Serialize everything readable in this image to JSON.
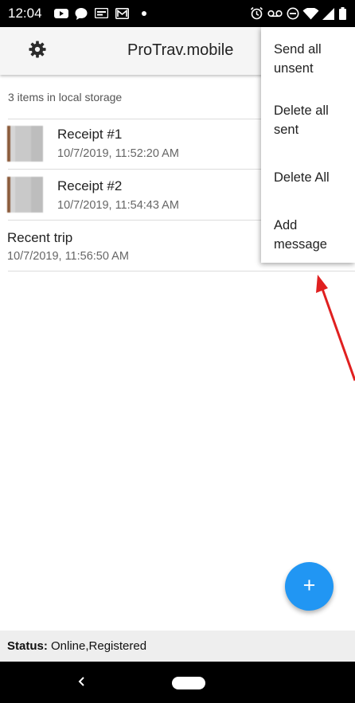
{
  "status_bar": {
    "time": "12:04",
    "icons": [
      "youtube-icon",
      "chat-icon",
      "gmail-card-icon",
      "gmail-icon",
      "dot-icon",
      "alarm-icon",
      "voicemail-icon",
      "do-not-disturb-icon",
      "wifi-icon",
      "signal-icon",
      "battery-icon"
    ]
  },
  "app_bar": {
    "title": "ProTrav.mobile",
    "settings_icon": "gear-icon"
  },
  "storage": {
    "count_text": "3 items in local storage"
  },
  "items": [
    {
      "title": "Receipt #1",
      "timestamp": "10/7/2019, 11:52:20 AM",
      "has_thumbnail": true
    },
    {
      "title": "Receipt #2",
      "timestamp": "10/7/2019, 11:54:43 AM",
      "has_thumbnail": true
    },
    {
      "title": "Recent trip",
      "timestamp": "10/7/2019, 11:56:50 AM",
      "has_thumbnail": false
    }
  ],
  "menu": {
    "items": [
      {
        "line1": "Send all",
        "line2": "unsent"
      },
      {
        "line1": "Delete all",
        "line2": "sent"
      },
      {
        "line1": "Delete All",
        "line2": ""
      },
      {
        "line1": "Add",
        "line2": "message"
      }
    ]
  },
  "fab": {
    "label": "+"
  },
  "footer": {
    "status_label": "Status:",
    "status_value": " Online,Registered"
  },
  "colors": {
    "fab": "#2196f3",
    "annotation_arrow": "#e02020",
    "app_bar": "#f5f5f5",
    "footer": "#eeeeee"
  }
}
